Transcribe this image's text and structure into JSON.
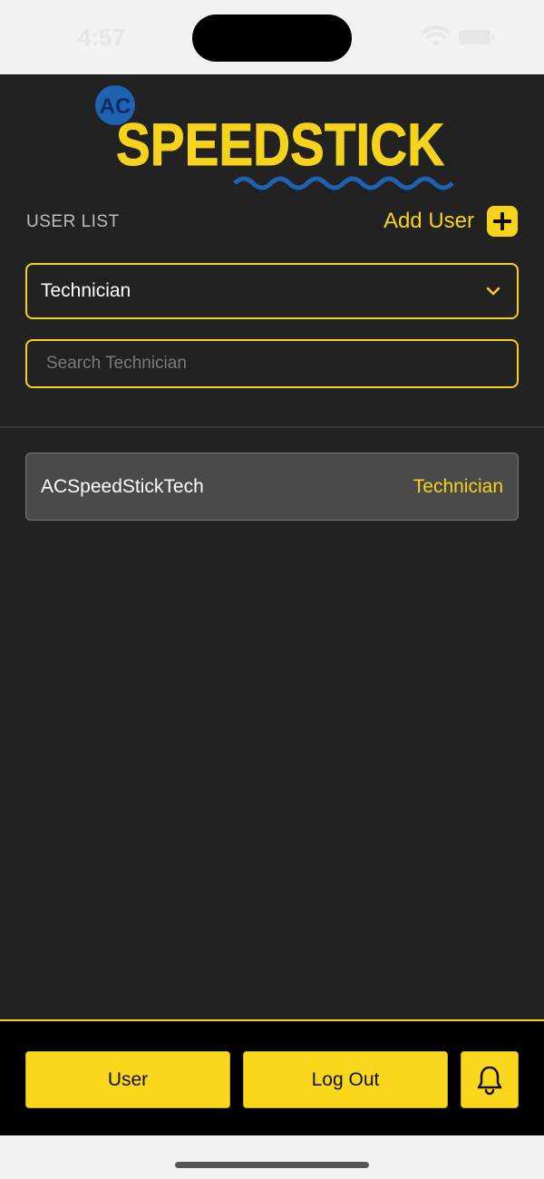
{
  "status_bar": {
    "time": "4:57"
  },
  "header": {
    "logo_badge": "AC",
    "logo_text": "SPEEDSTICK",
    "list_label": "USER LIST",
    "add_user_label": "Add User"
  },
  "filter": {
    "role_value": "Technician",
    "search_placeholder": "Search Technician",
    "search_value": ""
  },
  "users": [
    {
      "name": "ACSpeedStickTech",
      "role": "Technician"
    }
  ],
  "footer": {
    "user_label": "User",
    "logout_label": "Log Out",
    "bell_icon": "bell-icon"
  },
  "colors": {
    "accent": "#f5d31c",
    "background": "#222222",
    "row_bg": "#4a4a4a",
    "logo_blue": "#1f62b1"
  }
}
